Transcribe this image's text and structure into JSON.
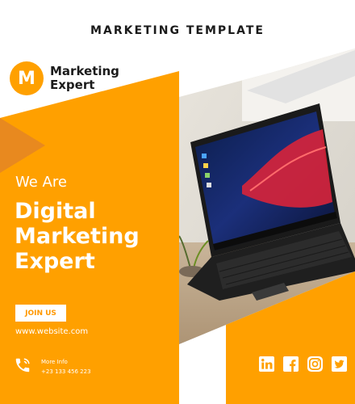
{
  "header": {
    "title": "MARKETING TEMPLATE"
  },
  "logo": {
    "letter": "M",
    "line1": "Marketing",
    "line2": "Expert"
  },
  "hero": {
    "kicker": "We Are",
    "headline_lines": [
      "Digital",
      "Marketing",
      "Expert"
    ]
  },
  "cta": {
    "label": "JOIN US"
  },
  "website": "www.website.com",
  "contact": {
    "title": "More Info",
    "phone": "+23 133 456 223"
  },
  "social_icons": [
    "linkedin-icon",
    "facebook-icon",
    "instagram-icon",
    "twitter-icon"
  ],
  "colors": {
    "orange": "#ffa000",
    "dark_orange": "#e8891f",
    "text_dark": "#1b1b1b",
    "white": "#ffffff"
  },
  "photo": {
    "subject": "laptop-on-desk-image"
  }
}
